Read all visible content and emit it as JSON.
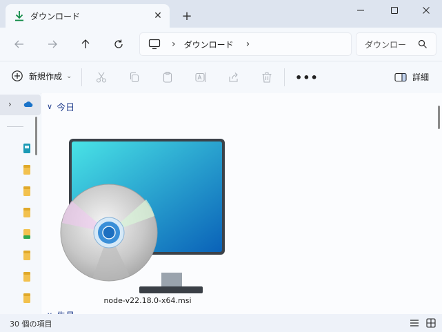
{
  "window": {
    "tab_title": "ダウンロード",
    "new_tab_symbol": "+",
    "close_tab_symbol": "✕"
  },
  "address": {
    "breadcrumb": "ダウンロード",
    "separator": "›"
  },
  "search": {
    "placeholder": "ダウンロード"
  },
  "toolbar": {
    "new_label": "新規作成",
    "more_label": "•••",
    "details_label": "詳細"
  },
  "content": {
    "group_label": "今日",
    "file_name": "node-v22.18.0-x64.msi",
    "next_group_label": "先月"
  },
  "status": {
    "item_count": "30 個の項目"
  },
  "colors": {
    "accent": "#0f7a3c",
    "group_text": "#1f3c8c",
    "titlebar": "#dde4ef",
    "pane": "#f5f8fc"
  }
}
